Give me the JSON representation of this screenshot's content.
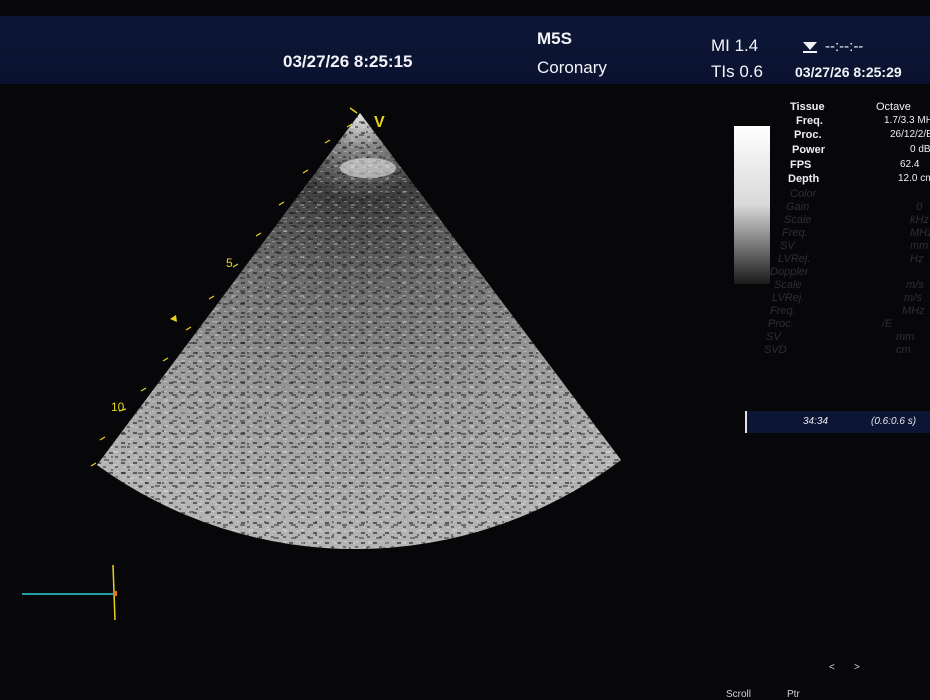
{
  "header": {
    "date_time": "03/27/26 8:25:15",
    "probe": "M5S",
    "preset": "Coronary",
    "mi": "MI 1.4",
    "tis": "TIs 0.6",
    "freeze_time": "--:--:--",
    "date_time_right": "03/27/26 8:25:29"
  },
  "image": {
    "orientation_marker": "V",
    "depth_labels": [
      "5",
      "10"
    ]
  },
  "params": [
    {
      "label": "Tissue",
      "value": "Octave"
    },
    {
      "label": "Freq.",
      "value": "1.7/3.3 MHz"
    },
    {
      "label": "Proc.",
      "value": "26/12/2/E"
    },
    {
      "label": "Power",
      "value": "0 dB"
    },
    {
      "label": "FPS",
      "value": "62.4"
    },
    {
      "label": "Depth",
      "value": "12.0 cm"
    }
  ],
  "params_dim": [
    {
      "label": "Color",
      "value": ""
    },
    {
      "label": "Gain",
      "value": "0"
    },
    {
      "label": "Scale",
      "value": "kHz"
    },
    {
      "label": "Freq.",
      "value": "MHz"
    },
    {
      "label": "SV",
      "value": "mm"
    },
    {
      "label": "LVRej.",
      "value": "Hz"
    },
    {
      "label": "Doppler",
      "value": ""
    },
    {
      "label": "Scale",
      "value": "m/s"
    },
    {
      "label": "LVRej.",
      "value": "m/s"
    },
    {
      "label": "Freq.",
      "value": "MHz"
    },
    {
      "label": "Proc.",
      "value": "/E"
    },
    {
      "label": "SV",
      "value": "mm"
    },
    {
      "label": "SVD",
      "value": "cm"
    }
  ],
  "cine": {
    "frame": "34:34",
    "range": "(0.6:0.6 s)"
  },
  "footer": {
    "scroll": "Scroll",
    "ptr": "Ptr"
  },
  "nav": {
    "prev": "<",
    "next": ">"
  },
  "colors": {
    "depth_marks": "#e8d21a",
    "header_bg": "#0d1735",
    "ecg_line": "#2fd1d6"
  }
}
